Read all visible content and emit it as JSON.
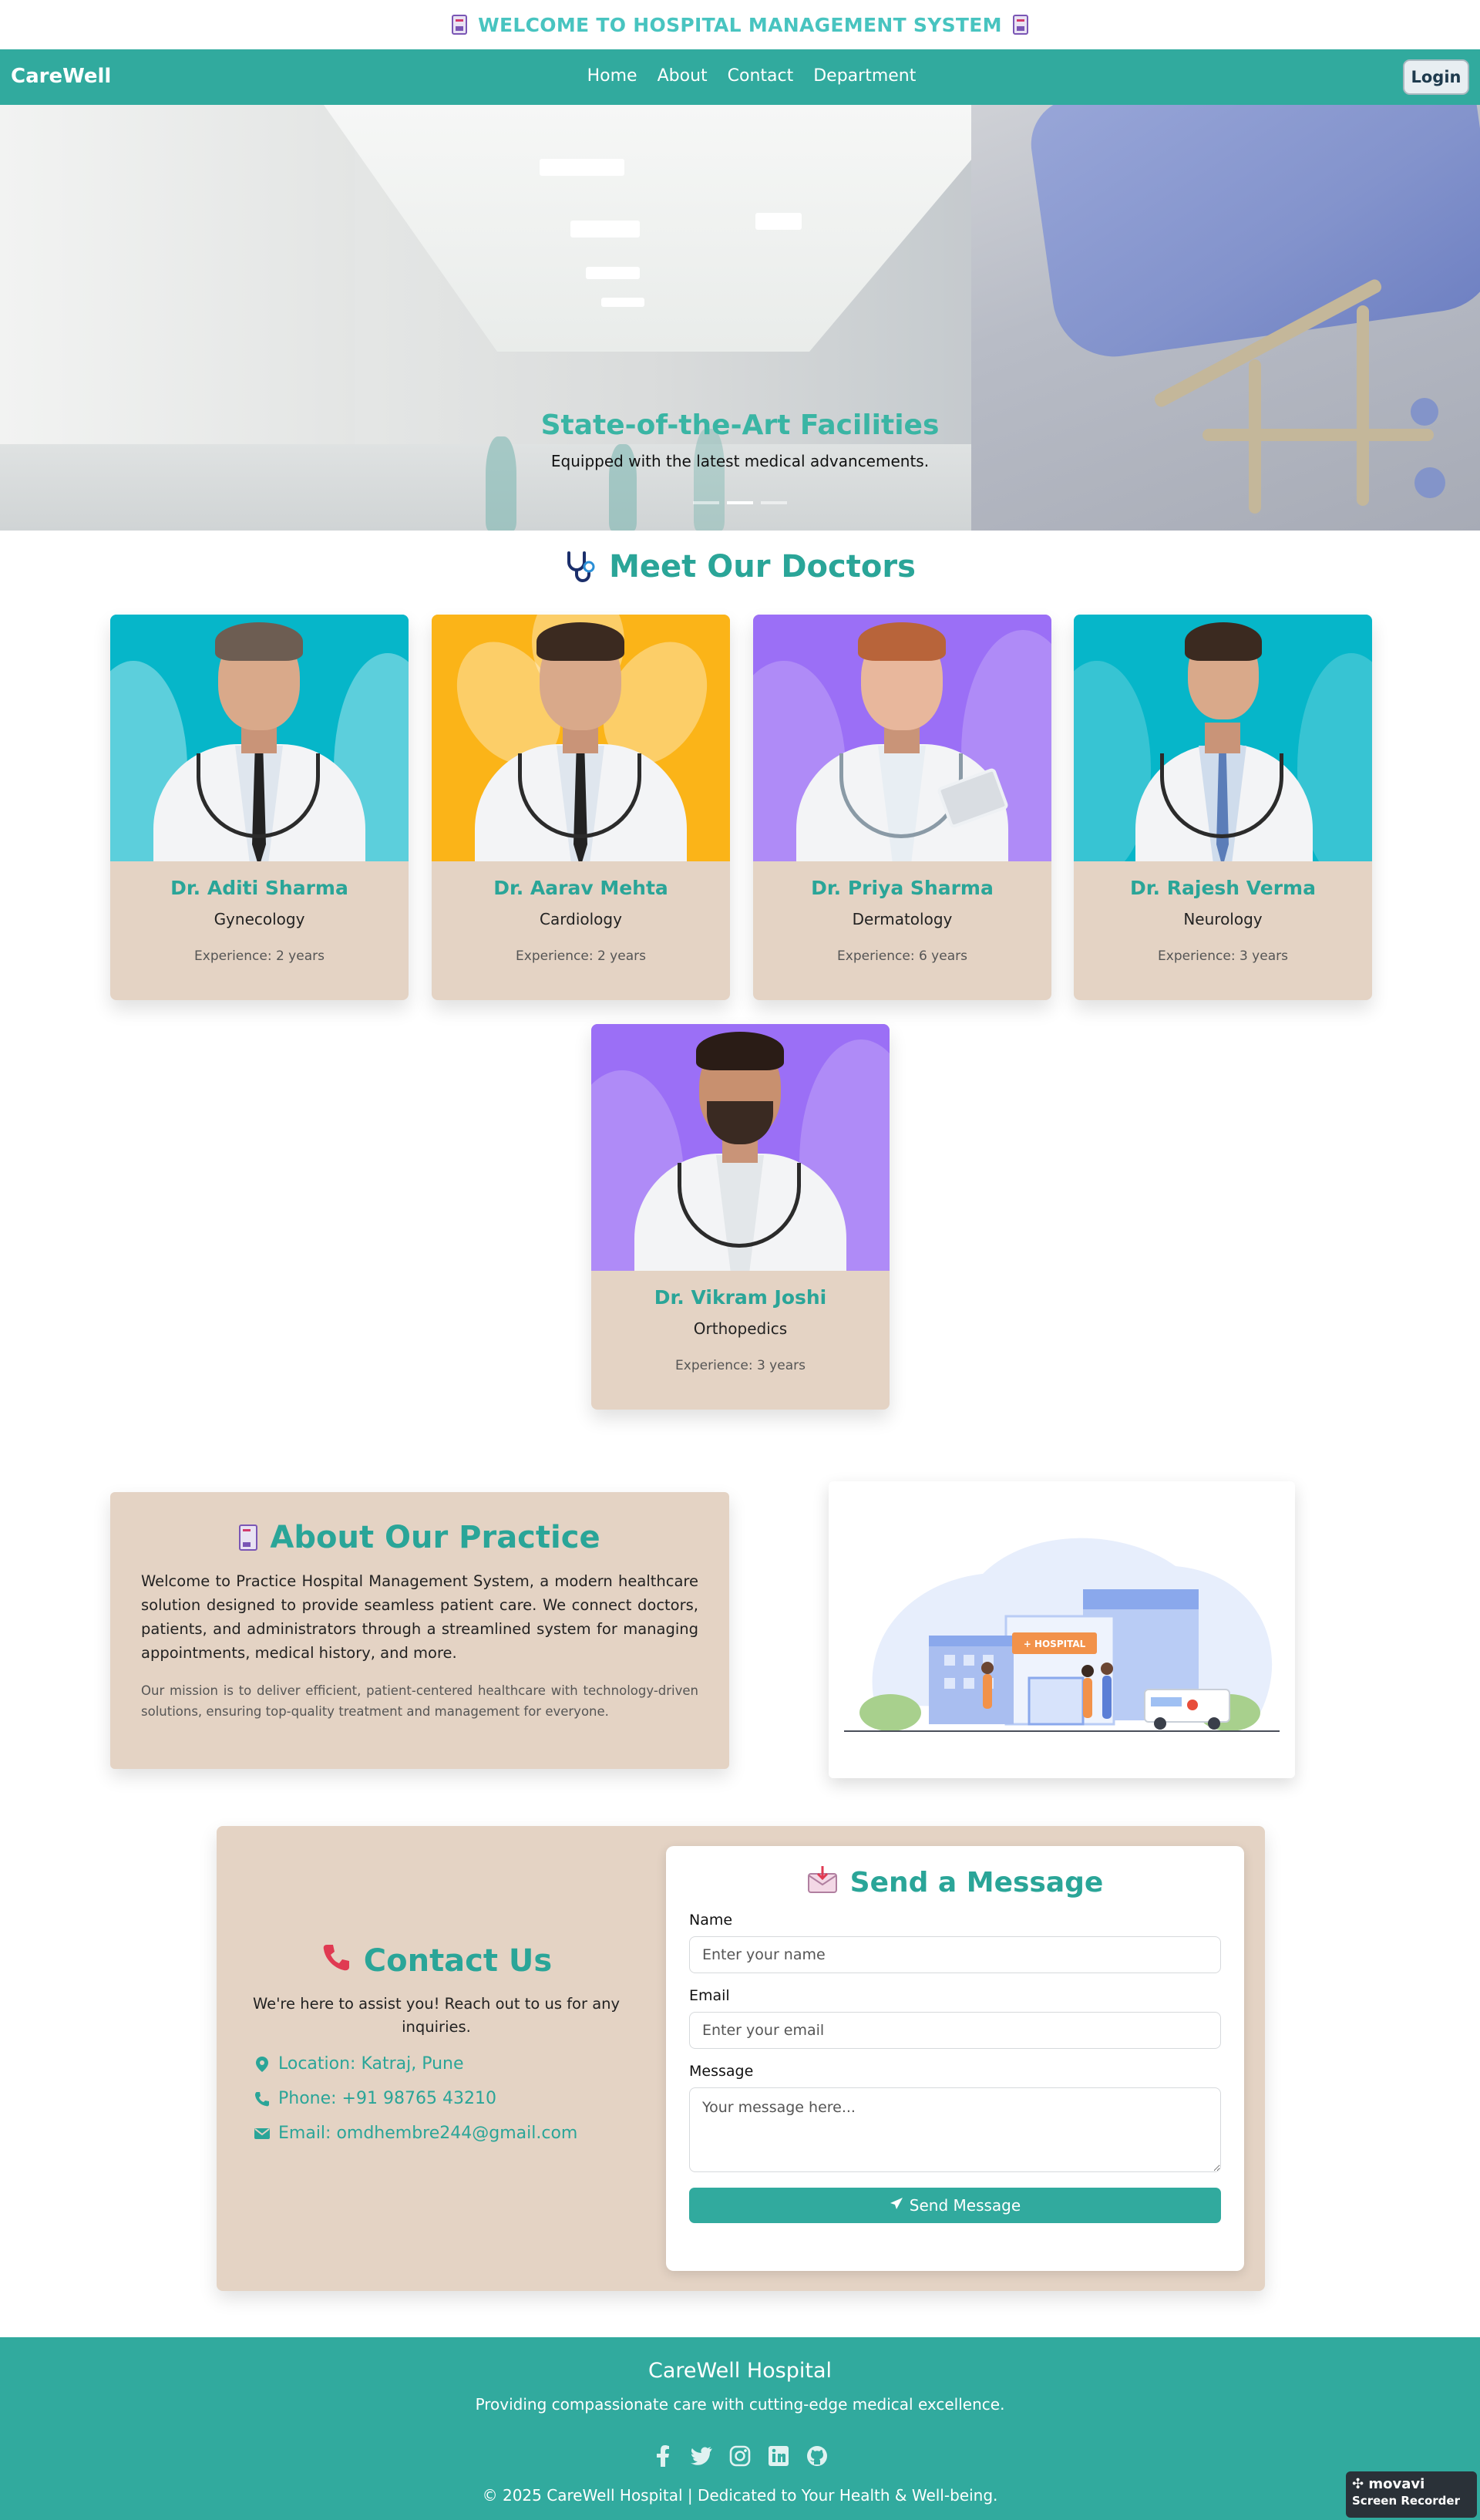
{
  "banner": {
    "text": "WELCOME TO HOSPITAL MANAGEMENT SYSTEM"
  },
  "navbar": {
    "brand": "CareWell",
    "links": [
      "Home",
      "About",
      "Contact",
      "Department"
    ],
    "login_label": "Login"
  },
  "hero": {
    "title": "State-of-the-Art Facilities",
    "subtitle": "Equipped with the latest medical advancements.",
    "slides_count": 3,
    "active_slide": 2
  },
  "doctors": {
    "title": "Meet Our Doctors",
    "items": [
      {
        "name": "Dr. Aditi Sharma",
        "specialty": "Gynecology",
        "experience": "Experience: 2 years",
        "bg": "#06b6c9"
      },
      {
        "name": "Dr. Aarav Mehta",
        "specialty": "Cardiology",
        "experience": "Experience: 2 years",
        "bg": "#fbb418"
      },
      {
        "name": "Dr. Priya Sharma",
        "specialty": "Dermatology",
        "experience": "Experience: 6 years",
        "bg": "#9b6ff6"
      },
      {
        "name": "Dr. Rajesh Verma",
        "specialty": "Neurology",
        "experience": "Experience: 3 years",
        "bg": "#06b6c9"
      },
      {
        "name": "Dr. Vikram Joshi",
        "specialty": "Orthopedics",
        "experience": "Experience: 3 years",
        "bg": "#9b6ff6"
      }
    ]
  },
  "about": {
    "title": "About Our Practice",
    "p1": "Welcome to Practice Hospital Management System, a modern healthcare solution designed to provide seamless patient care. We connect doctors, patients, and administrators through a streamlined system for managing appointments, medical history, and more.",
    "p2": "Our mission is to deliver efficient, patient-centered healthcare with technology-driven solutions, ensuring top-quality treatment and management for everyone.",
    "image_sign": "HOSPITAL"
  },
  "contact": {
    "title": "Contact Us",
    "intro": "We're here to assist you! Reach out to us for any inquiries.",
    "location": "Location: Katraj, Pune",
    "phone": "Phone: +91 98765 43210",
    "email": "Email: omdhembre244@gmail.com"
  },
  "form": {
    "title": "Send a Message",
    "name_label": "Name",
    "name_placeholder": "Enter your name",
    "email_label": "Email",
    "email_placeholder": "Enter your email",
    "message_label": "Message",
    "message_placeholder": "Your message here...",
    "submit_label": "Send Message"
  },
  "footer": {
    "title": "CareWell Hospital",
    "tagline": "Providing compassionate care with cutting-edge medical excellence.",
    "social": [
      "facebook-icon",
      "twitter-icon",
      "instagram-icon",
      "linkedin-icon",
      "github-icon"
    ],
    "copyright": "© 2025 CareWell Hospital | Dedicated to Your Health & Well-being."
  },
  "watermark": {
    "line1": "movavi",
    "line2": "Screen Recorder"
  },
  "colors": {
    "primary": "#31aa9e",
    "heading": "#2aa598",
    "card_bg": "#e4d3c4"
  }
}
